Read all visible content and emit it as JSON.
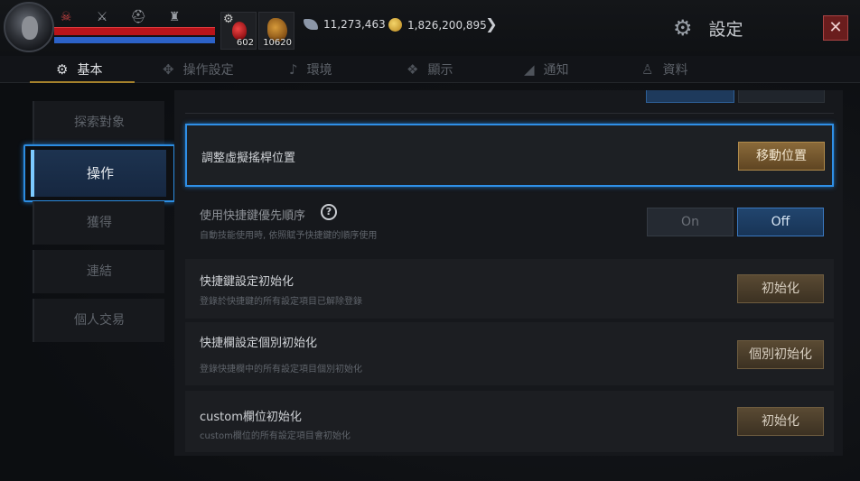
{
  "header": {
    "hp_mp": "",
    "items": [
      {
        "icon": "potion-icon",
        "count": "602"
      },
      {
        "icon": "horn-icon",
        "count": "10620"
      }
    ],
    "currencies": [
      {
        "icon": "feather-icon",
        "value": "11,273,463"
      },
      {
        "icon": "gold-coin-icon",
        "value": "1,826,200,895"
      }
    ],
    "title": "設定",
    "close": "✕"
  },
  "tabs": [
    {
      "label": "基本",
      "icon": "gear-icon",
      "active": true
    },
    {
      "label": "操作設定",
      "icon": "dpad-icon"
    },
    {
      "label": "環境",
      "icon": "music-note-icon"
    },
    {
      "label": "顯示",
      "icon": "display-icon"
    },
    {
      "label": "通知",
      "icon": "megaphone-icon"
    },
    {
      "label": "資料",
      "icon": "user-icon"
    }
  ],
  "sidebar": {
    "items": [
      {
        "label": "探索對象"
      },
      {
        "label": "操作",
        "active": true
      },
      {
        "label": "獲得"
      },
      {
        "label": "連結"
      },
      {
        "label": "個人交易"
      }
    ]
  },
  "rows": {
    "joystick": {
      "title": "調整虛擬搖桿位置",
      "button": "移動位置"
    },
    "shortcut_priority": {
      "title": "使用快捷鍵優先順序",
      "desc": "自動技能使用時, 依照賦予快捷鍵的順序使用",
      "help": "?",
      "on": "On",
      "off": "Off",
      "value": "Off"
    },
    "shortcut_reset": {
      "title": "快捷鍵設定初始化",
      "desc": "登錄於快捷鍵的所有設定項目已解除登錄",
      "button": "初始化"
    },
    "shortcutbar_reset": {
      "title": "快捷欄設定個別初始化",
      "desc": "登錄快捷欄中的所有設定項目個別初始化",
      "button": "個別初始化"
    },
    "custom_reset": {
      "title": "custom欄位初始化",
      "desc": "custom欄位的所有設定項目會初始化",
      "button": "初始化"
    }
  },
  "colors": {
    "accent_blue": "#2f8fe6",
    "hp": "#b8141a",
    "mp": "#2c62c8",
    "tab_gold": "#a6822c"
  }
}
